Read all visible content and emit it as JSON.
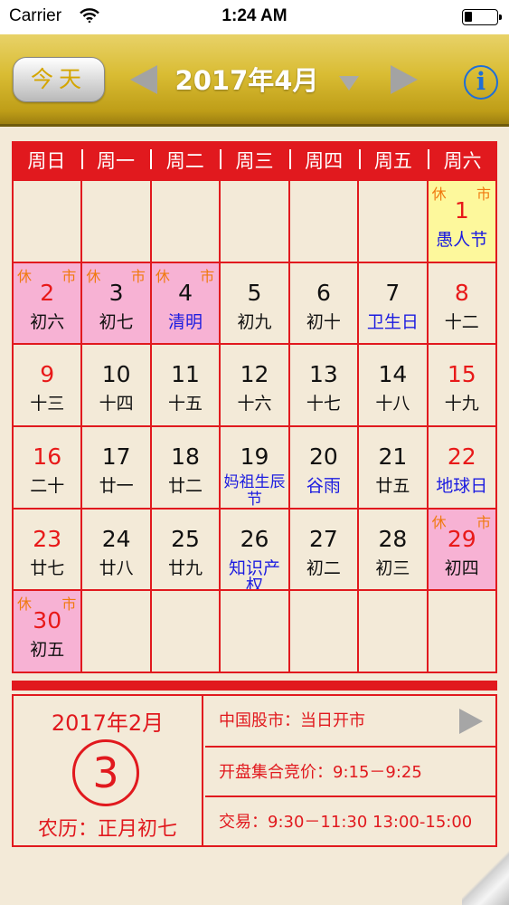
{
  "status": {
    "carrier": "Carrier",
    "time": "1:24 AM"
  },
  "toolbar": {
    "today_label": "今天",
    "month_title": "2017年4月"
  },
  "weekdays": [
    "周日",
    "周一",
    "周二",
    "周三",
    "周四",
    "周五",
    "周六"
  ],
  "colors": {
    "holiday_red": "#e1191e",
    "festival_blue": "#1c1ce0",
    "rest_orange": "#f07a10",
    "rest_pink": "#f7b2d4",
    "today_yellow": "#fdf89c",
    "toolbar_gold": "#d9bc33"
  },
  "cells": [
    {
      "day": "",
      "lunar": ""
    },
    {
      "day": "",
      "lunar": ""
    },
    {
      "day": "",
      "lunar": ""
    },
    {
      "day": "",
      "lunar": ""
    },
    {
      "day": "",
      "lunar": ""
    },
    {
      "day": "",
      "lunar": ""
    },
    {
      "day": "1",
      "lunar": "愚人节",
      "rest": "休",
      "market": "市"
    },
    {
      "day": "2",
      "lunar": "初六",
      "rest": "休",
      "market": "市"
    },
    {
      "day": "3",
      "lunar": "初七",
      "rest": "休",
      "market": "市"
    },
    {
      "day": "4",
      "lunar": "清明",
      "rest": "休",
      "market": "市"
    },
    {
      "day": "5",
      "lunar": "初九"
    },
    {
      "day": "6",
      "lunar": "初十"
    },
    {
      "day": "7",
      "lunar": "卫生日"
    },
    {
      "day": "8",
      "lunar": "十二"
    },
    {
      "day": "9",
      "lunar": "十三"
    },
    {
      "day": "10",
      "lunar": "十四"
    },
    {
      "day": "11",
      "lunar": "十五"
    },
    {
      "day": "12",
      "lunar": "十六"
    },
    {
      "day": "13",
      "lunar": "十七"
    },
    {
      "day": "14",
      "lunar": "十八"
    },
    {
      "day": "15",
      "lunar": "十九"
    },
    {
      "day": "16",
      "lunar": "二十"
    },
    {
      "day": "17",
      "lunar": "廿一"
    },
    {
      "day": "18",
      "lunar": "廿二"
    },
    {
      "day": "19",
      "lunar": "妈祖生辰节"
    },
    {
      "day": "20",
      "lunar": "谷雨"
    },
    {
      "day": "21",
      "lunar": "廿五"
    },
    {
      "day": "22",
      "lunar": "地球日"
    },
    {
      "day": "23",
      "lunar": "廿七"
    },
    {
      "day": "24",
      "lunar": "廿八"
    },
    {
      "day": "25",
      "lunar": "廿九"
    },
    {
      "day": "26",
      "lunar": "知识产权"
    },
    {
      "day": "27",
      "lunar": "初二"
    },
    {
      "day": "28",
      "lunar": "初三"
    },
    {
      "day": "29",
      "lunar": "初四",
      "rest": "休",
      "market": "市"
    },
    {
      "day": "30",
      "lunar": "初五",
      "rest": "休",
      "market": "市"
    },
    {
      "day": "",
      "lunar": ""
    },
    {
      "day": "",
      "lunar": ""
    },
    {
      "day": "",
      "lunar": ""
    },
    {
      "day": "",
      "lunar": ""
    },
    {
      "day": "",
      "lunar": ""
    },
    {
      "day": "",
      "lunar": ""
    }
  ],
  "selected": {
    "month": "2017年2月",
    "day": "3",
    "lunar": "农历：正月初七"
  },
  "market": {
    "status": "中国股市：当日开市",
    "auction": "开盘集合竞价：9:15－9:25",
    "trading": "交易：9:30－11:30  13:00-15:00"
  }
}
